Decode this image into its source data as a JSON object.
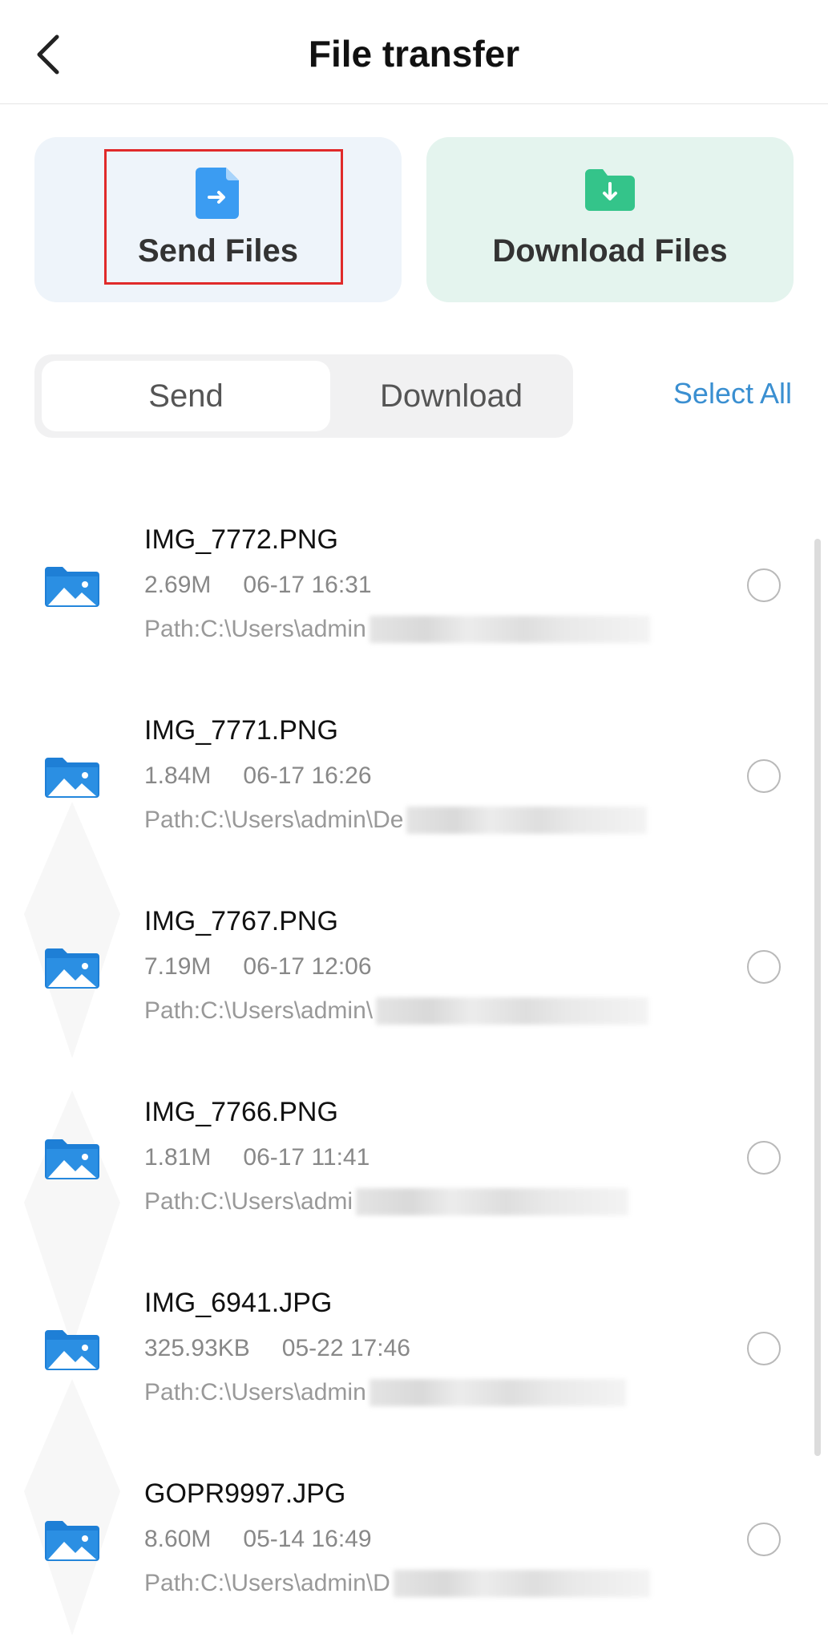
{
  "header": {
    "title": "File transfer",
    "back_icon": "chevron-left-icon"
  },
  "cards": {
    "send": {
      "label": "Send Files",
      "icon": "file-send-icon",
      "color": "#3b9cf2"
    },
    "download": {
      "label": "Download Files",
      "icon": "folder-download-icon",
      "color": "#34c48a"
    }
  },
  "tabs": {
    "items": [
      {
        "label": "Send",
        "active": true
      },
      {
        "label": "Download",
        "active": false
      }
    ]
  },
  "select_all_label": "Select All",
  "accent_color": "#3a8fd1",
  "files": [
    {
      "name": "IMG_7772.PNG",
      "size": "2.69M",
      "date": "06-17 16:31",
      "path": "Path:C:\\Users\\admin"
    },
    {
      "name": "IMG_7771.PNG",
      "size": "1.84M",
      "date": "06-17 16:26",
      "path": "Path:C:\\Users\\admin\\De"
    },
    {
      "name": "IMG_7767.PNG",
      "size": "7.19M",
      "date": "06-17 12:06",
      "path": "Path:C:\\Users\\admin\\"
    },
    {
      "name": "IMG_7766.PNG",
      "size": "1.81M",
      "date": "06-17 11:41",
      "path": "Path:C:\\Users\\admi"
    },
    {
      "name": "IMG_6941.JPG",
      "size": "325.93KB",
      "date": "05-22 17:46",
      "path": "Path:C:\\Users\\admin"
    },
    {
      "name": "GOPR9997.JPG",
      "size": "8.60M",
      "date": "05-14 16:49",
      "path": "Path:C:\\Users\\admin\\D"
    }
  ]
}
